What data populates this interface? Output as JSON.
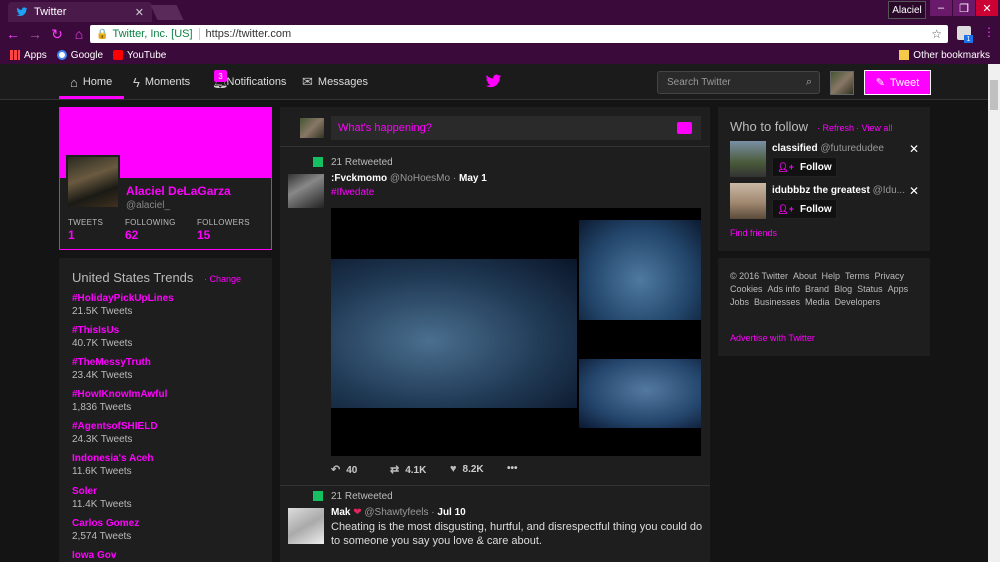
{
  "browser": {
    "tab_title": "Twitter",
    "profile_name": "Alaciel",
    "url_secure_label": "Twitter, Inc. [US]",
    "url": "https://twitter.com",
    "extension_badge": "1",
    "bookmarks": [
      {
        "label": "Apps"
      },
      {
        "label": "Google"
      },
      {
        "label": "YouTube"
      }
    ],
    "other_bookmarks": "Other bookmarks"
  },
  "nav": {
    "home": "Home",
    "moments": "Moments",
    "notifications": "Notifications",
    "notifications_badge": "3",
    "messages": "Messages",
    "search_placeholder": "Search Twitter",
    "tweet_button": "Tweet"
  },
  "profile": {
    "name": "Alaciel DeLaGarza",
    "handle": "@alaciel_",
    "stats": [
      {
        "label": "TWEETS",
        "value": "1"
      },
      {
        "label": "FOLLOWING",
        "value": "62"
      },
      {
        "label": "FOLLOWERS",
        "value": "15"
      }
    ]
  },
  "trends": {
    "title": "United States Trends",
    "change": "Change",
    "items": [
      {
        "name": "#HolidayPickUpLines",
        "count": "21.5K Tweets"
      },
      {
        "name": "#ThisIsUs",
        "count": "40.7K Tweets"
      },
      {
        "name": "#TheMessyTruth",
        "count": "23.4K Tweets"
      },
      {
        "name": "#HowIKnowImAwful",
        "count": "1,836 Tweets"
      },
      {
        "name": "#AgentsofSHIELD",
        "count": "24.3K Tweets"
      },
      {
        "name": "Indonesia's Aceh",
        "count": "11.6K Tweets"
      },
      {
        "name": "Soler",
        "count": "11.4K Tweets"
      },
      {
        "name": "Carlos Gomez",
        "count": "2,574 Tweets"
      },
      {
        "name": "Iowa Gov",
        "count": ""
      }
    ]
  },
  "compose": {
    "placeholder": "What's happening?"
  },
  "tweets": [
    {
      "retweeted": "21 Retweeted",
      "name": ":Fvckmomo",
      "handle": "@NoHoesMo",
      "sep": "·",
      "date": "May 1",
      "text": "#Ifwedate",
      "replies": "40",
      "retweets": "4.1K",
      "likes": "8.2K",
      "more": "•••"
    },
    {
      "retweeted": "21 Retweeted",
      "name": "Mak",
      "handle": "@Shawtyfeels",
      "sep": "·",
      "date": "Jul 10",
      "text": "Cheating is the most disgusting, hurtful, and disrespectful thing you could do to someone you say you love & care about."
    }
  ],
  "who_to_follow": {
    "title": "Who to follow",
    "refresh": "Refresh",
    "view_all": "View all",
    "follow_label": "Follow",
    "users": [
      {
        "name": "classified",
        "handle": "@futuredudee"
      },
      {
        "name": "idubbbz the greatest",
        "handle": "@Idu..."
      }
    ],
    "find_friends": "Find friends"
  },
  "footer": {
    "links": [
      "© 2016 Twitter",
      "About",
      "Help",
      "Terms",
      "Privacy",
      "Cookies",
      "Ads info",
      "Brand",
      "Blog",
      "Status",
      "Apps",
      "Jobs",
      "Businesses",
      "Media",
      "Developers"
    ],
    "advertise": "Advertise with Twitter"
  },
  "colors": {
    "accent": "#ff00ff",
    "chrome": "#3a0a3a",
    "background": "#141414"
  }
}
